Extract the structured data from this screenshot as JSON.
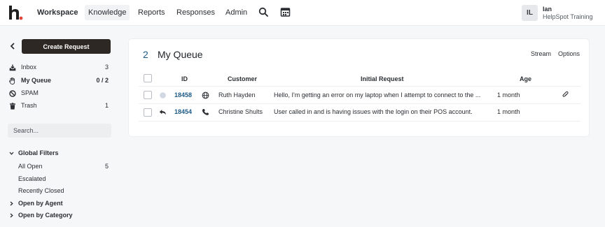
{
  "topbar": {
    "logo_letter": "h.",
    "nav": [
      "Workspace",
      "Knowledge",
      "Reports",
      "Responses",
      "Admin"
    ],
    "icons": [
      "search-icon",
      "calendar-icon"
    ],
    "user": {
      "initials": "IL",
      "name": "Ian",
      "org": "HelpSpot Training"
    }
  },
  "sidebar": {
    "create_label": "Create Request",
    "items": [
      {
        "label": "Inbox",
        "count": "3",
        "icon": "inbox-icon"
      },
      {
        "label": "My Queue",
        "count": "0 / 2",
        "icon": "hand-icon"
      },
      {
        "label": "SPAM",
        "count": "",
        "icon": "ban-icon"
      },
      {
        "label": "Trash",
        "count": "1",
        "icon": "trash-icon"
      }
    ],
    "search_placeholder": "Search...",
    "filters": {
      "global_label": "Global Filters",
      "global_items": [
        {
          "label": "All Open",
          "count": "5"
        },
        {
          "label": "Escalated",
          "count": ""
        },
        {
          "label": "Recently Closed",
          "count": ""
        }
      ],
      "by_agent": "Open by Agent",
      "by_category": "Open by Category"
    }
  },
  "queue": {
    "count": "2",
    "title": "My Queue",
    "stream": "Stream",
    "options": "Options",
    "columns": [
      "ID",
      "Customer",
      "Initial Request",
      "Age"
    ],
    "rows": [
      {
        "id": "18458",
        "customer": "Ruth Hayden",
        "request": "Hello, I'm getting an error on my laptop when I attempt to connect to the ...",
        "age": "1 month",
        "status_icon": "unread-dot-icon",
        "channel_icon": "globe-icon",
        "attachment": true
      },
      {
        "id": "18454",
        "customer": "Christine Shults",
        "request": "User called in and is having issues with the login on their POS account.",
        "age": "1 month",
        "status_icon": "reply-icon",
        "channel_icon": "phone-icon",
        "attachment": false
      }
    ]
  }
}
